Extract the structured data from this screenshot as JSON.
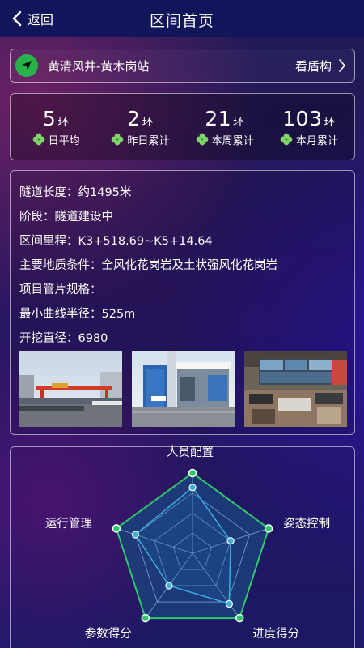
{
  "header": {
    "back_label": "返回",
    "title": "区间首页"
  },
  "route": {
    "name": "黄清风井-黄木岗站",
    "link_label": "看盾构"
  },
  "stats": [
    {
      "value": "5",
      "unit": "环",
      "label": "日平均"
    },
    {
      "value": "2",
      "unit": "环",
      "label": "昨日累计"
    },
    {
      "value": "21",
      "unit": "环",
      "label": "本周累计"
    },
    {
      "value": "103",
      "unit": "环",
      "label": "本月累计"
    }
  ],
  "info": [
    "隧道长度：约1495米",
    "阶段：隧道建设中",
    "区间里程：K3+518.69~K5+14.64",
    "主要地质条件：全风化花岗岩及土状强风化花岗岩",
    "项目管片规格：",
    "最小曲线半径：525m",
    "开挖直径：6980"
  ],
  "radar": {
    "axes": [
      "人员配置",
      "姿态控制",
      "进度得分",
      "参数得分",
      "运行管理"
    ],
    "max_scale": [
      1,
      1,
      1,
      1,
      1
    ],
    "score": [
      0.82,
      0.5,
      0.78,
      0.5,
      0.75
    ],
    "colors": {
      "max": "#2fc86a",
      "score": "#3aaee0",
      "fill": "#1c3b78"
    }
  },
  "colors": {
    "accent_green": "#27b34a",
    "header": "#12155a"
  }
}
